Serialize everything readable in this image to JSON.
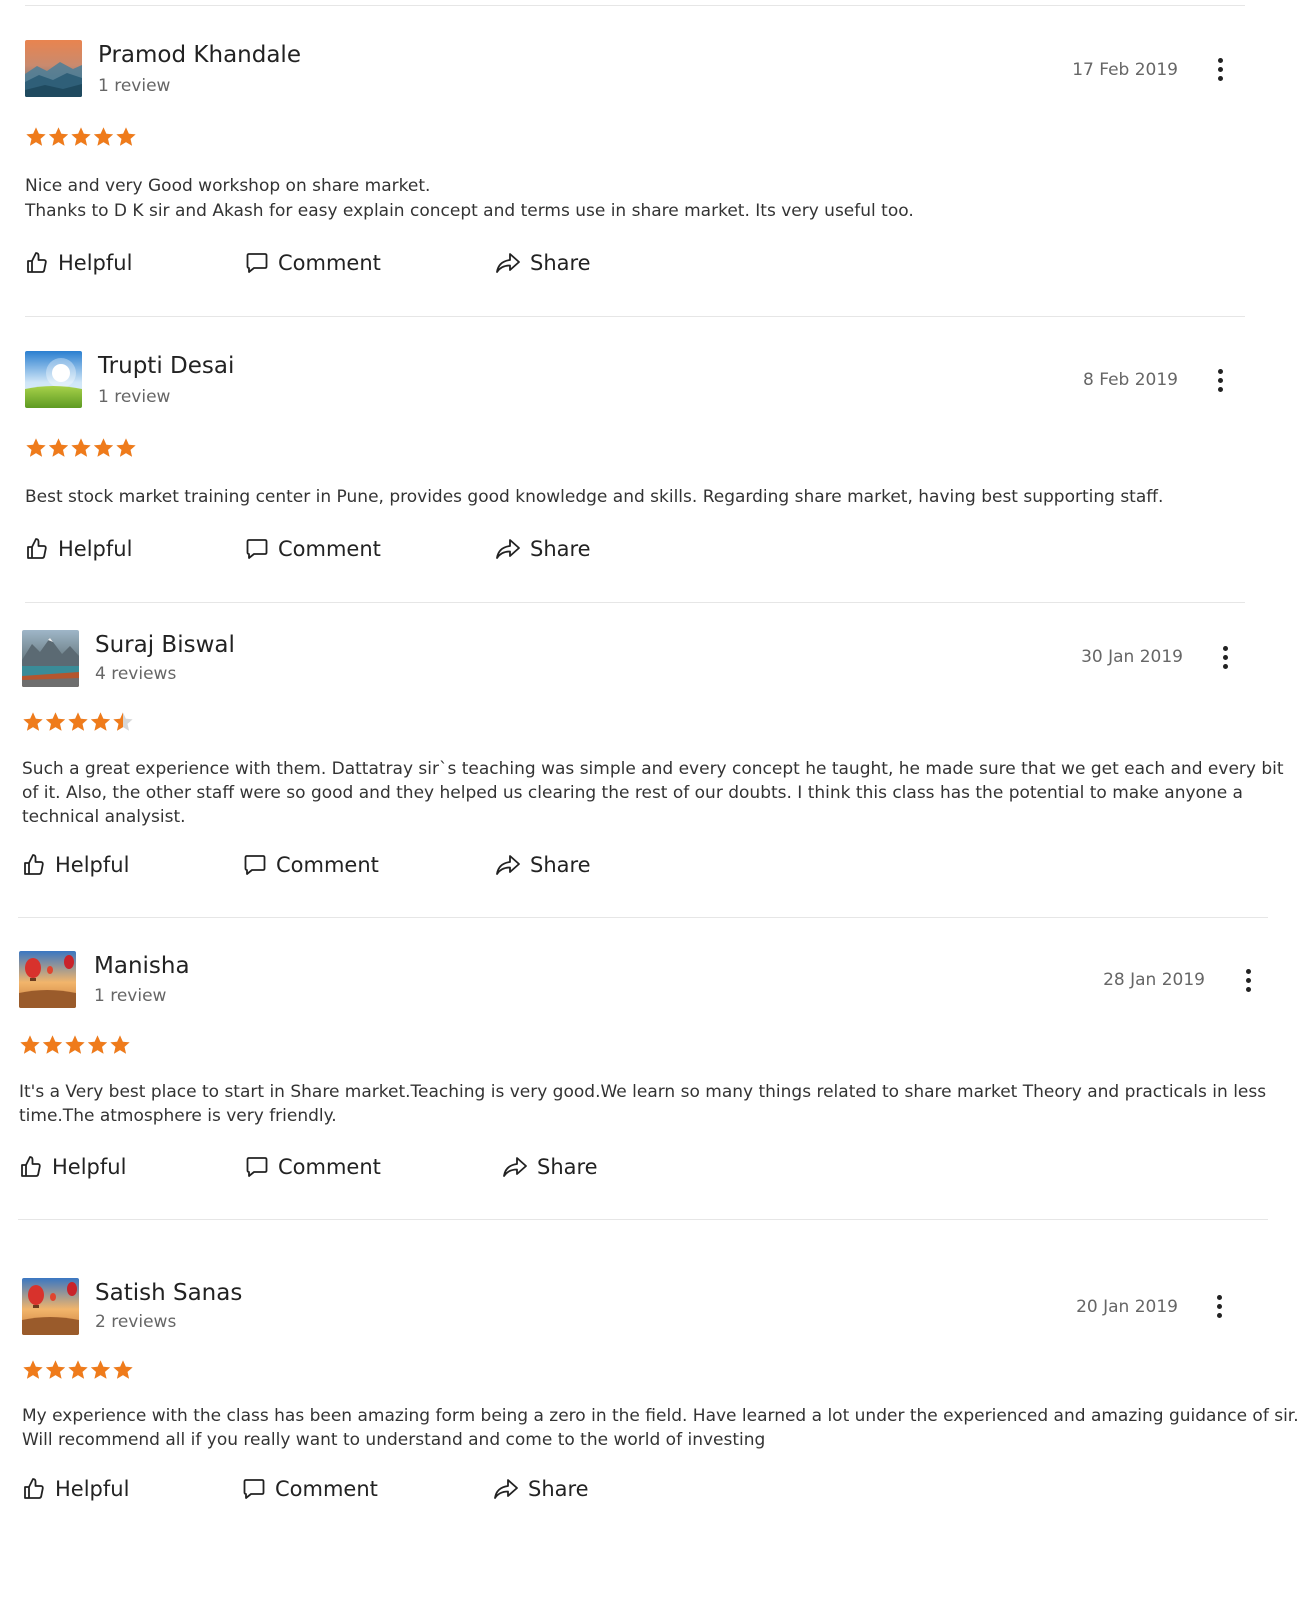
{
  "colors": {
    "star": "#ef7b1b",
    "star_empty": "#d7d7d7",
    "divider": "#e6e6e6"
  },
  "actions": {
    "helpful": "Helpful",
    "comment": "Comment",
    "share": "Share"
  },
  "reviews": [
    {
      "name": "Pramod Khandale",
      "review_count": "1 review",
      "date": "17 Feb 2019",
      "rating": 5,
      "avatar": "mountain-sunset",
      "text_lines": [
        "Nice and very Good workshop on share market.",
        "Thanks to D K sir and Akash for easy explain concept and terms use in share market. Its very useful too."
      ]
    },
    {
      "name": "Trupti Desai",
      "review_count": "1 review",
      "date": "8 Feb 2019",
      "rating": 5,
      "avatar": "green-meadow",
      "text_lines": [
        "Best stock market training center in Pune, provides good knowledge and skills. Regarding share market, having best supporting staff."
      ]
    },
    {
      "name": "Suraj Biswal",
      "review_count": "4 reviews",
      "date": "30 Jan 2019",
      "rating": 4.5,
      "avatar": "mountain-lake",
      "text_lines": [
        "Such a great experience with them. Dattatray sir`s teaching was simple and every concept he taught, he made sure that we get each and every bit",
        "of it. Also, the other staff were so good and they helped us clearing the rest of our doubts. I think this class has the potential to make anyone a",
        "technical analysist."
      ]
    },
    {
      "name": "Manisha",
      "review_count": "1 review",
      "date": "28 Jan 2019",
      "rating": 5,
      "avatar": "hot-air-balloons",
      "text_lines": [
        "It's a Very best place to start in Share market.Teaching is very good.We learn so many things related to share market Theory and practicals in less",
        "time.The atmosphere is very friendly."
      ]
    },
    {
      "name": "Satish Sanas",
      "review_count": "2 reviews",
      "date": "20 Jan 2019",
      "rating": 5,
      "avatar": "hot-air-balloons",
      "text_lines": [
        "My experience with the class has been amazing form being a zero in the field. Have learned a lot under the experienced and amazing guidance of sir.",
        "Will recommend all if you really want to understand and come to the world of investing"
      ]
    }
  ]
}
